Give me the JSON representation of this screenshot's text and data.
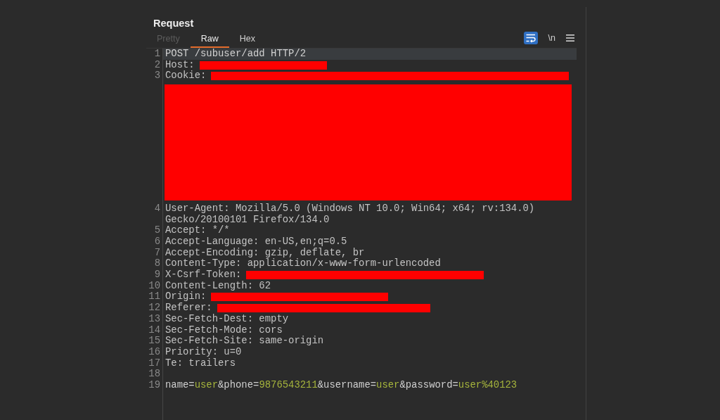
{
  "panel": {
    "title": "Request"
  },
  "tabs": [
    {
      "label": "Pretty",
      "selected": false,
      "disabled": true
    },
    {
      "label": "Raw",
      "selected": true,
      "disabled": false
    },
    {
      "label": "Hex",
      "selected": false,
      "disabled": false
    }
  ],
  "toolbar": [
    {
      "kind": "wrap",
      "on": true
    },
    {
      "kind": "text",
      "label": "\\n",
      "on": false
    },
    {
      "kind": "menu"
    }
  ],
  "lines": [
    {
      "number": "1",
      "kind": "text",
      "text": "POST /subuser/add HTTP/2",
      "selected": true
    },
    {
      "number": "2",
      "kind": "redacted",
      "text": "Host:",
      "selected": false
    },
    {
      "number": "3",
      "kind": "redacted-multiline",
      "text": "Cookie:",
      "selected": false
    },
    {
      "number": "4",
      "kind": "text",
      "text": "User-Agent: Mozilla/5.0 (Windows NT 10.0; Win64; x64; rv:134.0) Gecko/20100101 Firefox/134.0",
      "selected": false
    },
    {
      "number": "5",
      "kind": "text",
      "text": "Accept: */*",
      "selected": false
    },
    {
      "number": "6",
      "kind": "text",
      "text": "Accept-Language: en-US,en;q=0.5",
      "selected": false
    },
    {
      "number": "7",
      "kind": "text",
      "text": "Accept-Encoding: gzip, deflate, br",
      "selected": false
    },
    {
      "number": "8",
      "kind": "text",
      "text": "Content-Type: application/x-www-form-urlencoded",
      "selected": false
    },
    {
      "number": "9",
      "kind": "redacted",
      "text": "X-Csrf-Token:",
      "selected": false
    },
    {
      "number": "10",
      "kind": "text",
      "text": "Content-Length: 62",
      "selected": false
    },
    {
      "number": "11",
      "kind": "redacted",
      "text": "Origin:",
      "selected": false
    },
    {
      "number": "12",
      "kind": "redacted",
      "text": "Referer:",
      "selected": false
    },
    {
      "number": "13",
      "kind": "text",
      "text": "Sec-Fetch-Dest: empty",
      "selected": false
    },
    {
      "number": "14",
      "kind": "text",
      "text": "Sec-Fetch-Mode: cors",
      "selected": false
    },
    {
      "number": "15",
      "kind": "text",
      "text": "Sec-Fetch-Site: same-origin",
      "selected": false
    },
    {
      "number": "16",
      "kind": "text",
      "text": "Priority: u=0",
      "selected": false
    },
    {
      "number": "17",
      "kind": "text",
      "text": "Te: trailers",
      "selected": false
    },
    {
      "number": "18",
      "kind": "blank",
      "selected": false
    },
    {
      "number": "19",
      "kind": "body",
      "selected": false,
      "segments": [
        {
          "kind": "key",
          "text": "name="
        },
        {
          "kind": "value",
          "text": "user"
        },
        {
          "kind": "key",
          "text": "&phone="
        },
        {
          "kind": "value",
          "text": "9876543211"
        },
        {
          "kind": "key",
          "text": "&username="
        },
        {
          "kind": "value",
          "text": "user"
        },
        {
          "kind": "key",
          "text": "&password="
        },
        {
          "kind": "value",
          "text": "user%40123"
        }
      ]
    }
  ]
}
